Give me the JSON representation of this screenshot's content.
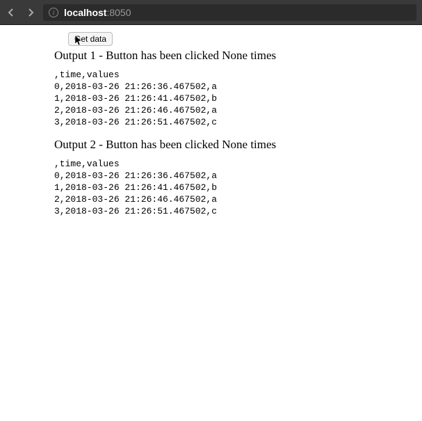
{
  "browser": {
    "url_host": "localhost",
    "url_port": ":8050"
  },
  "page": {
    "button_label": "Get data",
    "output1": {
      "heading": "Output 1 - Button has been clicked None times",
      "csv": ",time,values\n0,2018-03-26 21:26:36.467502,a\n1,2018-03-26 21:26:41.467502,b\n2,2018-03-26 21:26:46.467502,a\n3,2018-03-26 21:26:51.467502,c"
    },
    "output2": {
      "heading": "Output 2 - Button has been clicked None times",
      "csv": ",time,values\n0,2018-03-26 21:26:36.467502,a\n1,2018-03-26 21:26:41.467502,b\n2,2018-03-26 21:26:46.467502,a\n3,2018-03-26 21:26:51.467502,c"
    }
  }
}
